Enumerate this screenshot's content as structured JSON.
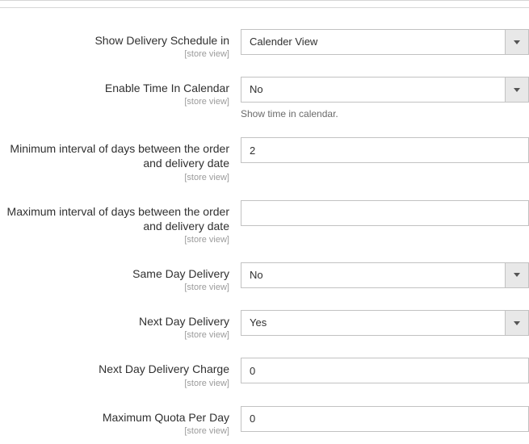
{
  "scope_label": "[store view]",
  "fields": {
    "show_schedule": {
      "label": "Show Delivery Schedule in",
      "value": "Calender View"
    },
    "enable_time": {
      "label": "Enable Time In Calendar",
      "value": "No",
      "help": "Show time in calendar."
    },
    "min_interval": {
      "label": "Minimum interval of days between the order and delivery date",
      "value": "2"
    },
    "max_interval": {
      "label": "Maximum interval of days between the order and delivery date",
      "value": ""
    },
    "same_day": {
      "label": "Same Day Delivery",
      "value": "No"
    },
    "next_day": {
      "label": "Next Day Delivery",
      "value": "Yes"
    },
    "next_day_charge": {
      "label": "Next Day Delivery Charge",
      "value": "0"
    },
    "max_quota": {
      "label": "Maximum Quota Per Day",
      "value": "0"
    }
  }
}
